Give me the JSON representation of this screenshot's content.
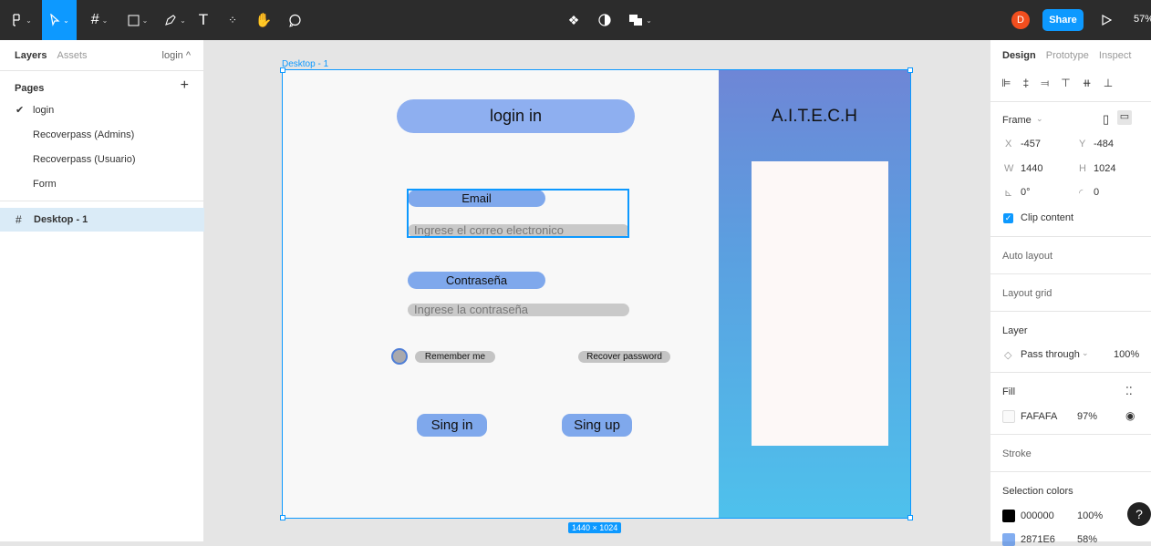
{
  "toolbar": {
    "share_label": "Share",
    "avatar_letter": "D",
    "zoom": "57%"
  },
  "left_panel": {
    "tabs": [
      "Layers",
      "Assets"
    ],
    "current_page": "login ^",
    "pages_title": "Pages",
    "add_label": "+",
    "pages": [
      {
        "label": "login",
        "selected": true
      },
      {
        "label": "Recoverpass (Admins)",
        "selected": false
      },
      {
        "label": "Recoverpass (Usuario)",
        "selected": false
      },
      {
        "label": "Form",
        "selected": false
      }
    ],
    "layer": {
      "icon": "frame-icon",
      "name": "Desktop - 1"
    }
  },
  "canvas": {
    "frame_label": "Desktop - 1",
    "size_badge": "1440 × 1024",
    "design": {
      "title_pill": "login in",
      "brand": "A.I.T.E.C.H",
      "email_label": "Email",
      "email_placeholder": "Ingrese el correo electronico",
      "password_label": "Contraseña",
      "password_placeholder": "Ingrese la contraseña",
      "remember": "Remember me",
      "recover": "Recover password",
      "signin": "Sing in",
      "signup": "Sing up"
    }
  },
  "right_panel": {
    "tabs": [
      "Design",
      "Prototype",
      "Inspect"
    ],
    "frame_title": "Frame",
    "x_key": "X",
    "x_val": "-457",
    "y_key": "Y",
    "y_val": "-484",
    "w_key": "W",
    "w_val": "1440",
    "h_key": "H",
    "h_val": "1024",
    "rotation": "0°",
    "radius": "0",
    "clip_content": "Clip content",
    "auto_layout": "Auto layout",
    "layout_grid": "Layout grid",
    "layer_title": "Layer",
    "blend_mode": "Pass through",
    "layer_opacity": "100%",
    "fill_title": "Fill",
    "fill_hex": "FAFAFA",
    "fill_opacity": "97%",
    "stroke": "Stroke",
    "selection_colors": "Selection colors",
    "colors": [
      {
        "hex": "000000",
        "opacity": "100%",
        "color": "#000000"
      },
      {
        "hex": "2871E6",
        "opacity": "58%",
        "color": "#2871E6"
      }
    ]
  },
  "help_label": "?"
}
